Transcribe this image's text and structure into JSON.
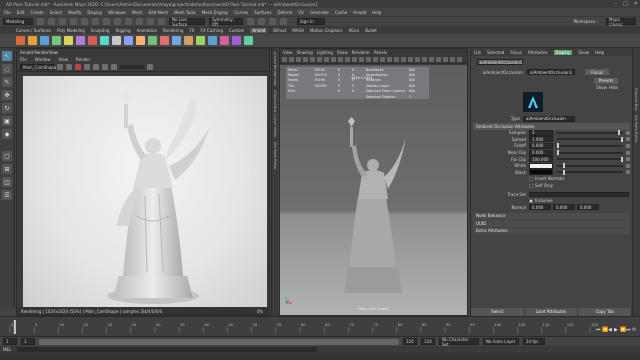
{
  "titlebar": {
    "title": "AO Pass Tutorial.mb* - Autodesk Maya 2020: C:\\Users\\Admin\\Documents\\maya\\projects\\default\\scenes\\AO Pass Tutorial.mb* --- aiAmbientOcclusion1"
  },
  "menubar": {
    "items": [
      "File",
      "Edit",
      "Create",
      "Select",
      "Modify",
      "Display",
      "Windows",
      "Mesh",
      "Edit Mesh",
      "Mesh Tools",
      "Mesh Display",
      "Curves",
      "Surfaces",
      "Deform",
      "UV",
      "Generate",
      "Cache",
      "Arnold",
      "Help"
    ],
    "workspace_label": "Workspace :",
    "workspace_value": "Maya Classic"
  },
  "statusline": {
    "mode": "Modeling",
    "live_label": "No Live Surface",
    "symmetry": "Symmetry: Off",
    "signin": "Sign In"
  },
  "shelf": {
    "tabs": [
      "Curves / Surfaces",
      "Poly Modeling",
      "Sculpting",
      "Rigging",
      "Animation",
      "Rendering",
      "FX",
      "FX Caching",
      "Custom",
      "Arnold",
      "Bifrost",
      "MASH",
      "Motion Graphics",
      "XGen",
      "Bullet"
    ],
    "active_tab": "Arnold",
    "buttons": [
      "#d86a3a",
      "#e4a23c",
      "#5aa0d8",
      "#7ec07e",
      "#e0d35c",
      "#b07cd8",
      "#d85a5a",
      "#5ad8c8",
      "#c8c8c8",
      "#8aa0ff",
      "#ffb070",
      "#70c070",
      "#e07070",
      "#6fa8dc",
      "#d0a060",
      "#a0d060",
      "#60a0d0",
      "#d060a0",
      "#a060d0",
      "#60d0a0"
    ]
  },
  "renderview": {
    "title": "Arnold RenderView",
    "menu": [
      "File",
      "Window",
      "View",
      "Render"
    ],
    "camera": "Main_CamShape",
    "status": "Rendering | 1024x1024 (50%) | Main_CamShape | samples 3/4/4/0/0/0",
    "zoom": "4%"
  },
  "side_tabs": [
    "Arnold RenderView",
    "Channel Box / Layer Editor",
    "Attribute Editor"
  ],
  "viewport": {
    "menu": [
      "View",
      "Shading",
      "Lighting",
      "Show",
      "Renderer",
      "Panels"
    ],
    "resolution": "1024 x 1024",
    "hud": [
      [
        "Verts:",
        "70534",
        "0",
        "0",
        "Backfaces:",
        "N/A"
      ],
      [
        "Edges:",
        "140719",
        "0",
        "0",
        "Smoothness:",
        "N/A"
      ],
      [
        "Faces:",
        "70196",
        "0",
        "0",
        "Instance:",
        "N/A"
      ],
      [
        "Tris:",
        "140392",
        "0",
        "0",
        "Display Layer:",
        "N/A"
      ],
      [
        "UVs:",
        "",
        "0",
        "0",
        "Distance From Camera:",
        "N/A"
      ],
      [
        "",
        "",
        "",
        "",
        "Selected Objects:",
        "1"
      ]
    ],
    "camera_label": "Main_Cam (Lock)"
  },
  "attribute_editor": {
    "tabs": [
      "List",
      "Selected",
      "Focus",
      "Attributes",
      "Display",
      "Show",
      "Help"
    ],
    "active_tab": "Display",
    "node_tab": "aiAmbientOcclusion1",
    "node_label": "aiAmbientOcclusion:",
    "node_value": "aiAmbientOcclusion1",
    "focus_btn": "Focus",
    "presets_btn": "Presets",
    "show_btn": "Show",
    "hide_btn": "Hide",
    "type_label": "Type",
    "type_value": "aiAmbientOcclusion",
    "section_main": "Ambient Occlusion Attributes",
    "attrs": [
      {
        "label": "Samples",
        "value": "3",
        "slider": 0.95
      },
      {
        "label": "Spread",
        "value": "1.000",
        "slider": 1.0
      },
      {
        "label": "Falloff",
        "value": "0.000",
        "slider": 0.0
      },
      {
        "label": "Near Clip",
        "value": "0.000",
        "slider": 0.0
      },
      {
        "label": "Far Clip",
        "value": "100.000",
        "slider": 1.0
      },
      {
        "label": "White",
        "value": "",
        "slider": 0.1
      },
      {
        "label": "Black",
        "value": "",
        "slider": 0.1
      }
    ],
    "check_invert": "Invert Normals",
    "check_self": "Self Only",
    "trace_set": "Trace Set",
    "inclusive": "Inclusive",
    "normal_label": "Normal",
    "normal_values": [
      "0.000",
      "0.000",
      "0.000"
    ],
    "sections": [
      "Node Behavior",
      "UUID",
      "Extra Attributes"
    ],
    "bottom_buttons": [
      "Select",
      "Load Attributes",
      "Copy Tab"
    ]
  },
  "timeline": {
    "ticks": [
      "0",
      "5",
      "10",
      "15",
      "20",
      "25",
      "30",
      "35",
      "40",
      "45",
      "50",
      "55",
      "60",
      "65",
      "70",
      "75",
      "80",
      "85",
      "90",
      "95",
      "100",
      "105",
      "110",
      "115",
      "120"
    ],
    "current_frame": "1"
  },
  "range": {
    "start": "1",
    "range_start": "1",
    "range_end": "120",
    "end": "120",
    "character_set": "No Character Set",
    "anim_layer": "No Anim Layer",
    "fps": "24 fps"
  },
  "cmdline": {
    "mel": "MEL"
  },
  "helpline": {
    "text": ""
  }
}
